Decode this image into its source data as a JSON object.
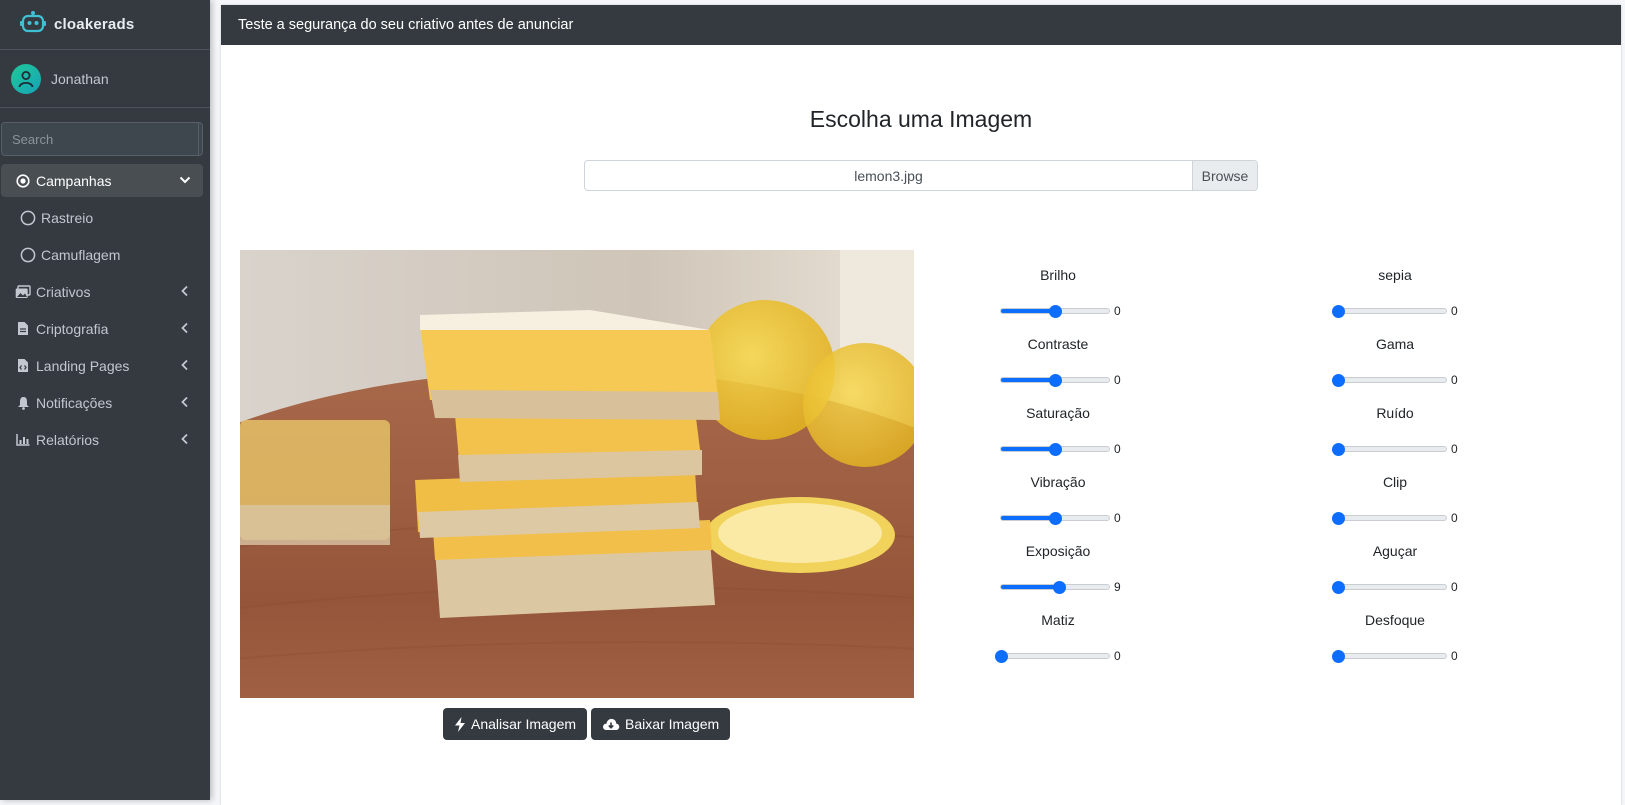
{
  "sidebar": {
    "brand": "cloakerads",
    "user": "Jonathan",
    "search_placeholder": "Search",
    "items": [
      {
        "label": "Campanhas",
        "icon": "circle-dot-icon",
        "active": true,
        "chevron": "down"
      },
      {
        "label": "Rastreio",
        "icon": "circle-icon",
        "sub": true
      },
      {
        "label": "Camuflagem",
        "icon": "circle-icon",
        "sub": true
      },
      {
        "label": "Criativos",
        "icon": "images-icon",
        "chevron": "left"
      },
      {
        "label": "Criptografia",
        "icon": "file-icon",
        "chevron": "left"
      },
      {
        "label": "Landing Pages",
        "icon": "file-code-icon",
        "chevron": "left"
      },
      {
        "label": "Notificações",
        "icon": "bell-icon",
        "chevron": "left"
      },
      {
        "label": "Relatórios",
        "icon": "chart-icon",
        "chevron": "left"
      }
    ]
  },
  "header": {
    "title": "Teste a segurança do seu criativo antes de anunciar"
  },
  "main": {
    "choose_title": "Escolha uma Imagem",
    "file_name": "lemon3.jpg",
    "browse_label": "Browse",
    "analyze_label": "Analisar Imagem",
    "download_label": "Baixar Imagem"
  },
  "controls_left": [
    {
      "label": "Brilho",
      "value": "0",
      "fraction": 0.5
    },
    {
      "label": "Contraste",
      "value": "0",
      "fraction": 0.5
    },
    {
      "label": "Saturação",
      "value": "0",
      "fraction": 0.5
    },
    {
      "label": "Vibração",
      "value": "0",
      "fraction": 0.5
    },
    {
      "label": "Exposição",
      "value": "9",
      "fraction": 0.54
    },
    {
      "label": "Matiz",
      "value": "0",
      "fraction": 0.0
    }
  ],
  "controls_right": [
    {
      "label": "sepia",
      "value": "0",
      "fraction": 0.0
    },
    {
      "label": "Gama",
      "value": "0",
      "fraction": 0.0
    },
    {
      "label": "Ruído",
      "value": "0",
      "fraction": 0.0
    },
    {
      "label": "Clip",
      "value": "0",
      "fraction": 0.0
    },
    {
      "label": "Aguçar",
      "value": "0",
      "fraction": 0.0
    },
    {
      "label": "Desfoque",
      "value": "0",
      "fraction": 0.0
    }
  ],
  "colors": {
    "accent": "#0d6efd",
    "sidebar": "#343a40",
    "brand_icon": "#3fc1d3"
  }
}
